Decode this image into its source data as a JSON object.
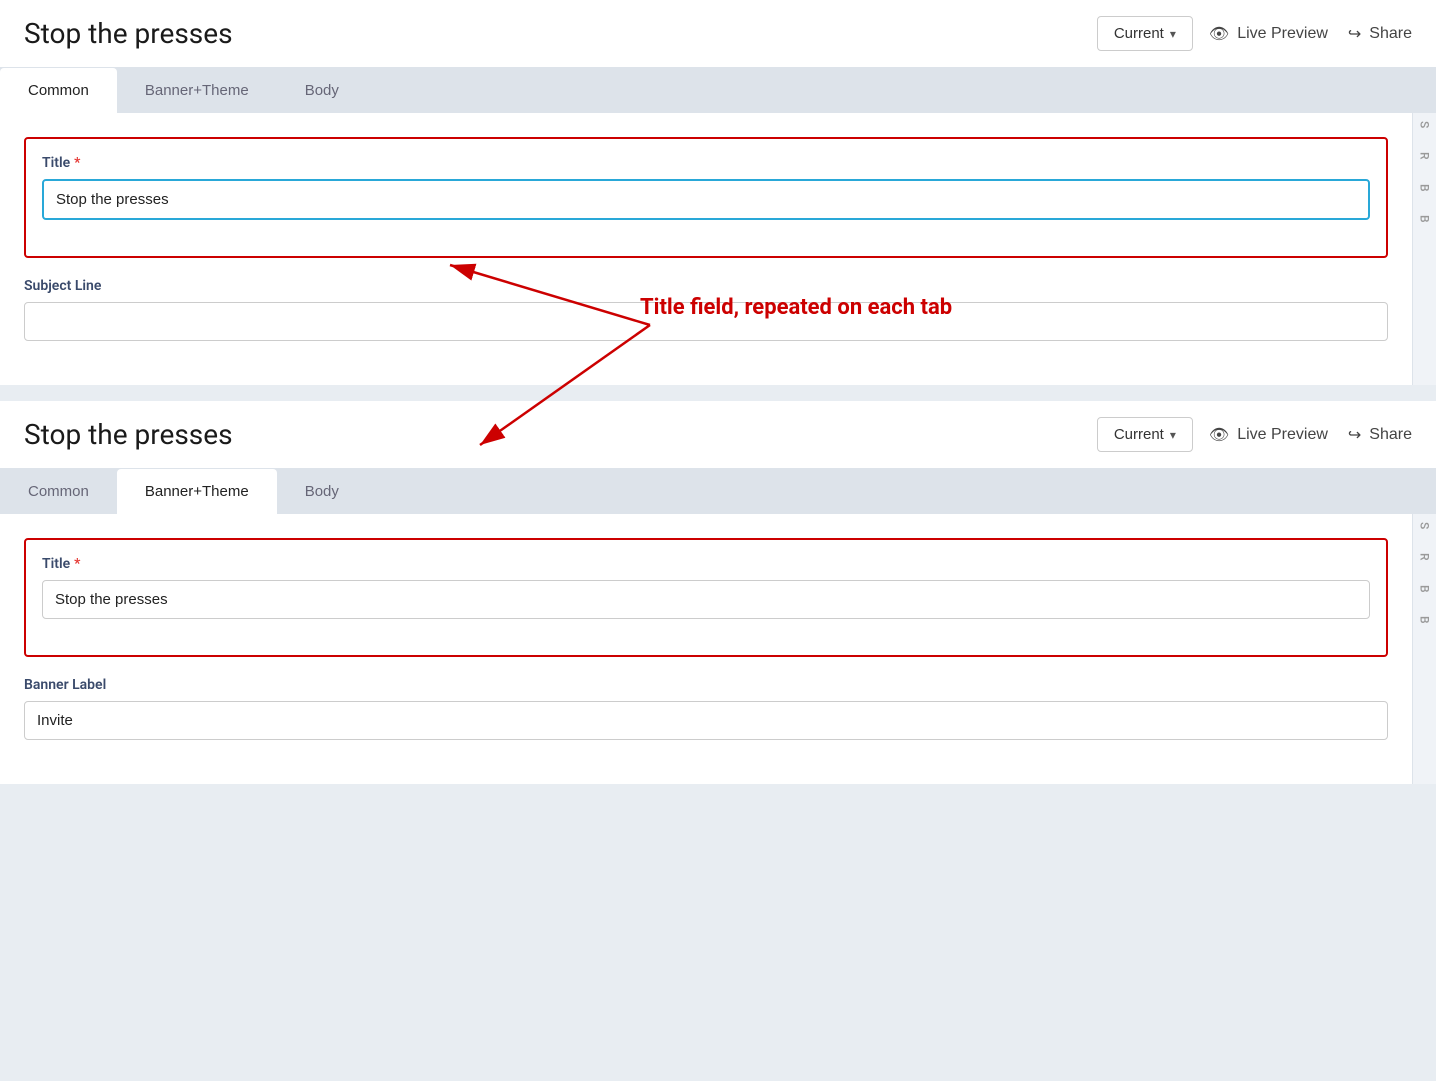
{
  "page": {
    "title": "Stop the presses"
  },
  "header": {
    "title": "Stop the presses",
    "version_label": "Current",
    "version_chevron": "▾",
    "live_preview_label": "Live Preview",
    "share_label": "Share"
  },
  "tabs": {
    "panel1": [
      {
        "id": "common",
        "label": "Common",
        "active": true
      },
      {
        "id": "banner-theme",
        "label": "Banner+Theme",
        "active": false
      },
      {
        "id": "body",
        "label": "Body",
        "active": false
      }
    ],
    "panel2": [
      {
        "id": "common2",
        "label": "Common",
        "active": false
      },
      {
        "id": "banner-theme2",
        "label": "Banner+Theme",
        "active": true
      },
      {
        "id": "body2",
        "label": "Body",
        "active": false
      }
    ]
  },
  "panel1": {
    "title_label": "Title",
    "title_required": "*",
    "title_value": "Stop the presses",
    "subject_line_label": "Subject Line",
    "subject_line_value": "",
    "subject_line_placeholder": ""
  },
  "panel2": {
    "title_label": "Title",
    "title_required": "*",
    "title_value": "Stop the presses",
    "banner_label_label": "Banner Label",
    "banner_label_value": "Invite"
  },
  "annotation": {
    "text": "Title field, repeated on each tab"
  },
  "sidebar": {
    "letters": [
      "S",
      "R",
      "B",
      "B"
    ]
  },
  "icons": {
    "eye": "👁",
    "share": "↪"
  }
}
